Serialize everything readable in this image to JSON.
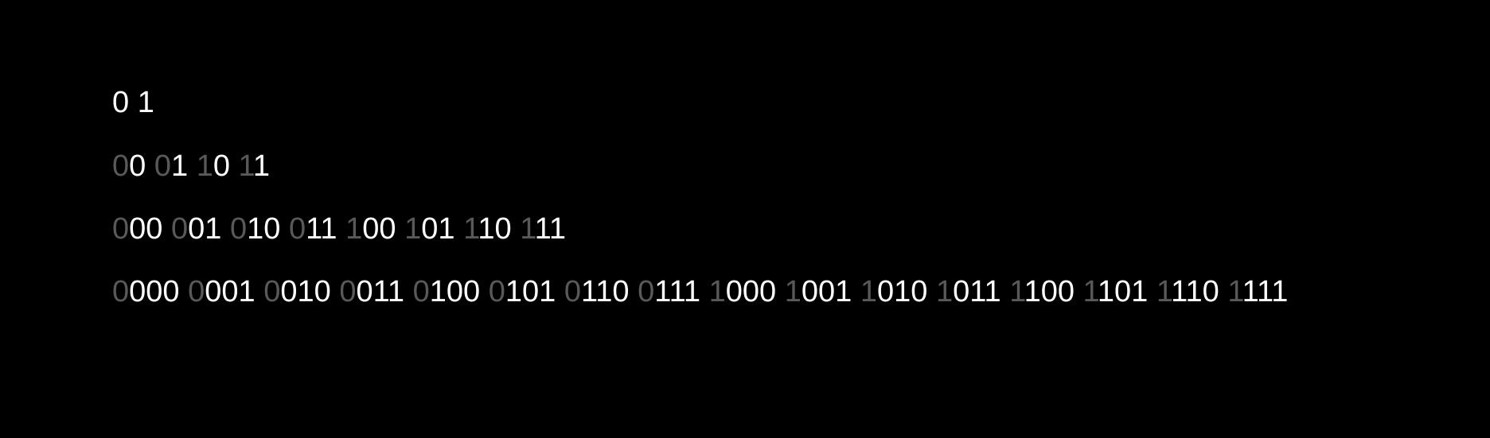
{
  "colors": {
    "background": "#000000",
    "text": "#ffffff",
    "prefix_dim": "#595959"
  },
  "rows": [
    {
      "codes": [
        {
          "prefix": "",
          "rest": "0"
        },
        {
          "prefix": "",
          "rest": "1"
        }
      ]
    },
    {
      "codes": [
        {
          "prefix": "0",
          "rest": "0"
        },
        {
          "prefix": "0",
          "rest": "1"
        },
        {
          "prefix": "1",
          "rest": "0"
        },
        {
          "prefix": "1",
          "rest": "1"
        }
      ]
    },
    {
      "codes": [
        {
          "prefix": "0",
          "rest": "00"
        },
        {
          "prefix": "0",
          "rest": "01"
        },
        {
          "prefix": "0",
          "rest": "10"
        },
        {
          "prefix": "0",
          "rest": "11"
        },
        {
          "prefix": "1",
          "rest": "00"
        },
        {
          "prefix": "1",
          "rest": "01"
        },
        {
          "prefix": "1",
          "rest": "10"
        },
        {
          "prefix": "1",
          "rest": "11"
        }
      ]
    },
    {
      "codes": [
        {
          "prefix": "0",
          "rest": "000"
        },
        {
          "prefix": "0",
          "rest": "001"
        },
        {
          "prefix": "0",
          "rest": "010"
        },
        {
          "prefix": "0",
          "rest": "011"
        },
        {
          "prefix": "0",
          "rest": "100"
        },
        {
          "prefix": "0",
          "rest": "101"
        },
        {
          "prefix": "0",
          "rest": "110"
        },
        {
          "prefix": "0",
          "rest": "111"
        },
        {
          "prefix": "1",
          "rest": "000"
        },
        {
          "prefix": "1",
          "rest": "001"
        },
        {
          "prefix": "1",
          "rest": "010"
        },
        {
          "prefix": "1",
          "rest": "011"
        },
        {
          "prefix": "1",
          "rest": "100"
        },
        {
          "prefix": "1",
          "rest": "101"
        },
        {
          "prefix": "1",
          "rest": "110"
        },
        {
          "prefix": "1",
          "rest": "111"
        }
      ]
    }
  ]
}
